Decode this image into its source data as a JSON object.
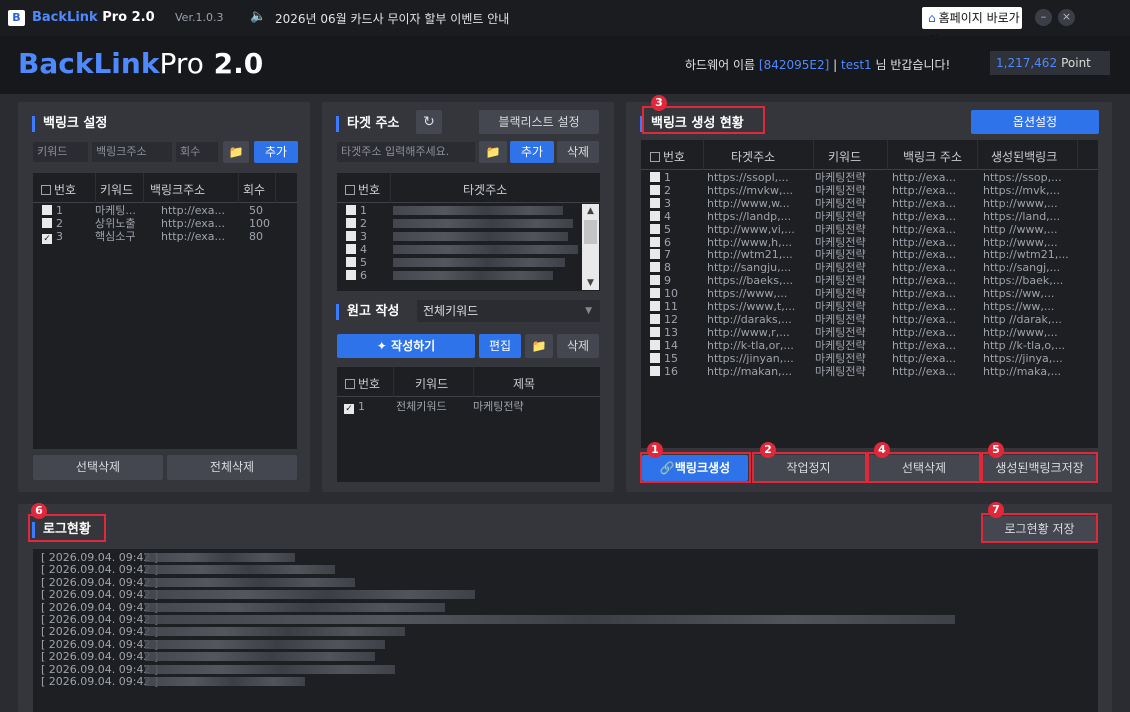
{
  "titlebar": {
    "logo": "B",
    "app_name": "BackLink",
    "app_name_suffix": " Pro 2.0",
    "version": "Ver.1.0.3",
    "notice": "2026년 06월 카드사 무이자 할부 이벤트 안내",
    "homepage_button": "홈페이지 바로가기",
    "minimize": "–",
    "close": "×"
  },
  "header": {
    "brand_main": "BackLink",
    "brand_pro": "Pro",
    "brand_version": " 2.0",
    "greeting_prefix": "하드웨어 이름",
    "hardware_id": "[842095E2]",
    "separator": "|",
    "user": "test1",
    "greeting_suffix": "님 반갑습니다!",
    "points": "1,217,462",
    "points_unit": "Point"
  },
  "backlink_settings": {
    "title": "백링크 설정",
    "keyword_placeholder": "키워드",
    "url_placeholder": "백링크주소",
    "count_placeholder": "회수",
    "add_button": "추가",
    "columns": [
      "번호",
      "키워드",
      "백링크주소",
      "회수"
    ],
    "rows": [
      {
        "no": "1",
        "keyword": "마케팅...",
        "url": "http://exa...",
        "count": "50",
        "checked": false
      },
      {
        "no": "2",
        "keyword": "상위노출",
        "url": "http://exa...",
        "count": "100",
        "checked": false
      },
      {
        "no": "3",
        "keyword": "핵심소구",
        "url": "http://exa...",
        "count": "80",
        "checked": true
      }
    ],
    "delete_selected": "선택삭제",
    "delete_all": "전체삭제"
  },
  "target": {
    "title": "타겟 주소",
    "blacklist_button": "블랙리스트 설정",
    "input_placeholder": "타겟주소 입력해주세요.",
    "add_button": "추가",
    "delete_button": "삭제",
    "columns": [
      "번호",
      "타겟주소"
    ],
    "rows": [
      "1",
      "2",
      "3",
      "4",
      "5",
      "6"
    ]
  },
  "manuscript": {
    "title": "원고 작성",
    "select_value": "전체키워드",
    "write_button": "작성하기",
    "edit_button": "편집",
    "delete_button": "삭제",
    "columns": [
      "번호",
      "키워드",
      "제목"
    ],
    "rows": [
      {
        "no": "1",
        "keyword": "전체키워드",
        "title": "마케팅전략",
        "checked": true
      }
    ]
  },
  "status": {
    "title": "백링크 생성 현황",
    "options_button": "옵션설정",
    "columns": [
      "번호",
      "타겟주소",
      "키워드",
      "백링크 주소",
      "생성된백링크"
    ],
    "rows": [
      {
        "no": "1",
        "target": "https://ssopl,...",
        "keyword": "마케팅전략",
        "url": "http://exa...",
        "generated": "https://ssop,..."
      },
      {
        "no": "2",
        "target": "https://mvkw,...",
        "keyword": "마케팅전략",
        "url": "http://exa...",
        "generated": "https://mvk,..."
      },
      {
        "no": "3",
        "target": "http://www,w...",
        "keyword": "마케팅전략",
        "url": "http://exa...",
        "generated": "http://www,..."
      },
      {
        "no": "4",
        "target": "https://landp,...",
        "keyword": "마케팅전략",
        "url": "http://exa...",
        "generated": "https://land,..."
      },
      {
        "no": "5",
        "target": "http://www,vi,...",
        "keyword": "마케팅전략",
        "url": "http://exa...",
        "generated": "http //www,..."
      },
      {
        "no": "6",
        "target": "http://www,h,...",
        "keyword": "마케팅전략",
        "url": "http://exa...",
        "generated": "http://www,..."
      },
      {
        "no": "7",
        "target": "http://wtm21,...",
        "keyword": "마케팅전략",
        "url": "http://exa...",
        "generated": "http://wtm21,..."
      },
      {
        "no": "8",
        "target": "http://sangju,...",
        "keyword": "마케팅전략",
        "url": "http://exa...",
        "generated": "http://sangj,..."
      },
      {
        "no": "9",
        "target": "https://baeks,...",
        "keyword": "마케팅전략",
        "url": "http://exa...",
        "generated": "https://baek,..."
      },
      {
        "no": "10",
        "target": "https://www,...",
        "keyword": "마케팅전략",
        "url": "http://exa...",
        "generated": "https://ww,..."
      },
      {
        "no": "11",
        "target": "https://www,t,...",
        "keyword": "마케팅전략",
        "url": "http://exa...",
        "generated": "https://ww,..."
      },
      {
        "no": "12",
        "target": "http://daraks,...",
        "keyword": "마케팅전략",
        "url": "http://exa...",
        "generated": "http //darak,..."
      },
      {
        "no": "13",
        "target": "http://www,r,...",
        "keyword": "마케팅전략",
        "url": "http://exa...",
        "generated": "http://www,..."
      },
      {
        "no": "14",
        "target": "http://k-tla,or,...",
        "keyword": "마케팅전략",
        "url": "http://exa...",
        "generated": "http //k-tla,o,..."
      },
      {
        "no": "15",
        "target": "https://jinyan,...",
        "keyword": "마케팅전략",
        "url": "http://exa...",
        "generated": "https://jinya,..."
      },
      {
        "no": "16",
        "target": "http://makan,...",
        "keyword": "마케팅전략",
        "url": "http://exa...",
        "generated": "http://maka,..."
      }
    ],
    "create_button": "백링크생성",
    "stop_button": "작업정지",
    "delete_selected": "선택삭제",
    "save_generated": "생성된백링크저장"
  },
  "log": {
    "title": "로그현황",
    "save_button": "로그현황 저장",
    "entries": [
      "[ 2026.09.04. 09:42 ]",
      "[ 2026.09.04. 09:42 ]",
      "[ 2026.09.04. 09:42 ]",
      "[ 2026.09.04. 09:42 ]",
      "[ 2026.09.04. 09:42 ]",
      "[ 2026.09.04. 09:42 ]",
      "[ 2026.09.04. 09:42 ]",
      "[ 2026.09.04. 09:42 ]",
      "[ 2026.09.04. 09:42 ]",
      "[ 2026.09.04. 09:42 ]",
      "[ 2026.09.04. 09:42 ]"
    ]
  },
  "markers": [
    "1",
    "2",
    "3",
    "4",
    "5",
    "6",
    "7"
  ],
  "colors": {
    "accent": "#2f73ea",
    "highlight": "#e0283a",
    "brand": "#4f89ff"
  },
  "icons": {
    "folder": "folder-icon",
    "refresh": "refresh-icon",
    "link": "link-icon",
    "magic": "magic-wand-icon",
    "home": "home-icon",
    "speaker": "speaker-icon"
  }
}
